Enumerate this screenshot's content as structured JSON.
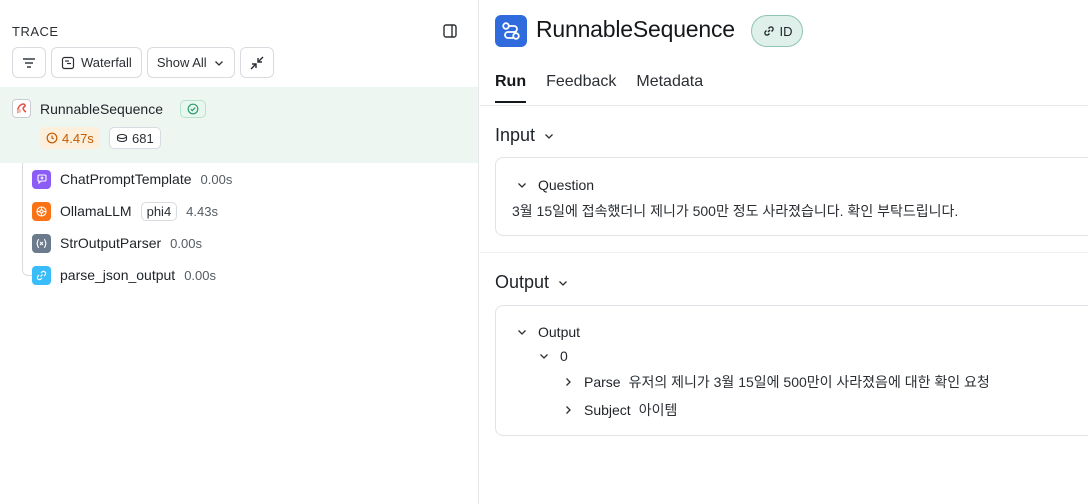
{
  "trace": {
    "title": "TRACE",
    "toolbar": {
      "waterfall_label": "Waterfall",
      "show_all_label": "Show All"
    },
    "root": {
      "name": "RunnableSequence",
      "latency": "4.47s",
      "tokens": "681"
    },
    "children": [
      {
        "name": "ChatPromptTemplate",
        "time": "0.00s",
        "model": "",
        "icon_color": "#8b5cf6"
      },
      {
        "name": "OllamaLLM",
        "time": "4.43s",
        "model": "phi4",
        "icon_color": "#f97316"
      },
      {
        "name": "StrOutputParser",
        "time": "0.00s",
        "model": "",
        "icon_color": "#6b7a8c"
      },
      {
        "name": "parse_json_output",
        "time": "0.00s",
        "model": "",
        "icon_color": "#38bdf8"
      }
    ]
  },
  "run": {
    "title": "RunnableSequence",
    "id_label": "ID",
    "tabs": [
      "Run",
      "Feedback",
      "Metadata"
    ],
    "input": {
      "heading": "Input",
      "key": "Question",
      "value": "3월 15일에 접속했더니 제니가 500만 정도 사라졌습니다. 확인 부탁드립니다."
    },
    "output": {
      "heading": "Output",
      "key": "Output",
      "index": "0",
      "fields": [
        {
          "key": "Parse",
          "value": "유저의 제니가 3월 15일에 500만이 사라졌음에 대한 확인 요청"
        },
        {
          "key": "Subject",
          "value": "아이템"
        }
      ]
    }
  },
  "colors": {
    "accent_blue": "#2f6bdc",
    "selected_row_bg": "#eef6f2",
    "latency_orange": "#c55a00",
    "id_badge_bg": "#dff0ea"
  }
}
